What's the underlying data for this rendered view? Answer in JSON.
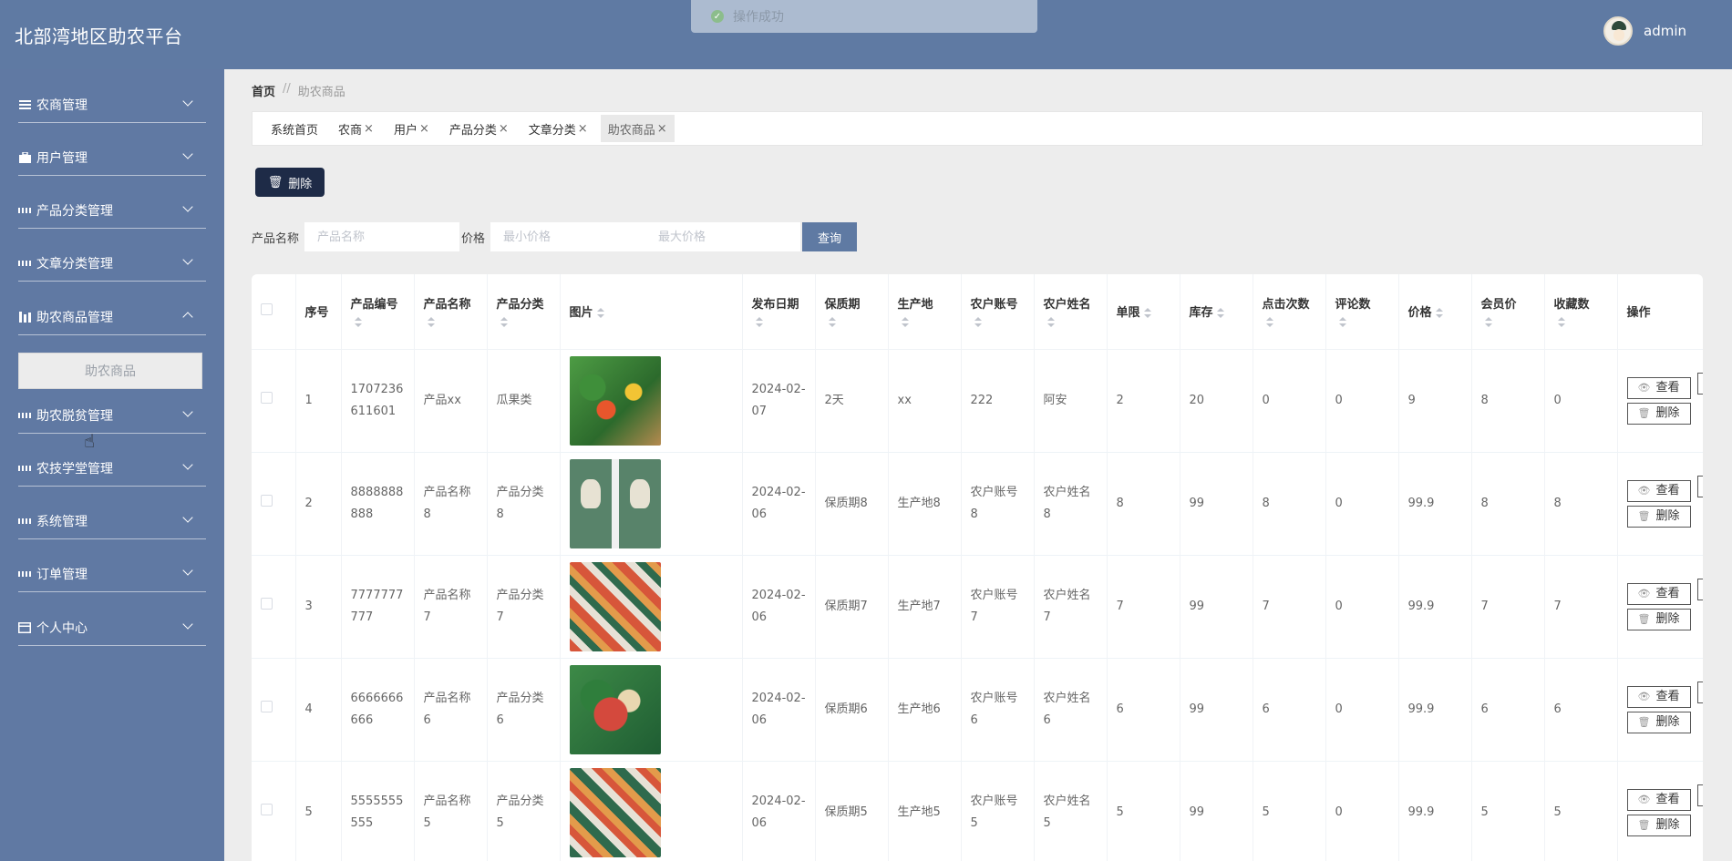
{
  "header": {
    "title": "北部湾地区助农平台",
    "username": "admin"
  },
  "toast": {
    "message": "操作成功"
  },
  "sidebar": {
    "items": [
      {
        "label": "农商管理",
        "icon": "list-icon"
      },
      {
        "label": "用户管理",
        "icon": "briefcase-icon"
      },
      {
        "label": "产品分类管理",
        "icon": "grid-icon"
      },
      {
        "label": "文章分类管理",
        "icon": "grid-icon"
      },
      {
        "label": "助农商品管理",
        "icon": "bar-chart-icon"
      },
      {
        "label": "助农脱贫管理",
        "icon": "grid-icon"
      },
      {
        "label": "农技学堂管理",
        "icon": "grid-icon"
      },
      {
        "label": "系统管理",
        "icon": "grid-icon"
      },
      {
        "label": "订单管理",
        "icon": "grid-icon"
      },
      {
        "label": "个人中心",
        "icon": "card-icon"
      }
    ],
    "sub_item": "助农商品"
  },
  "breadcrumb": {
    "home": "首页",
    "sep": "//",
    "current": "助农商品"
  },
  "tabs": [
    {
      "label": "系统首页",
      "closable": false
    },
    {
      "label": "农商",
      "closable": true
    },
    {
      "label": "用户",
      "closable": true
    },
    {
      "label": "产品分类",
      "closable": true
    },
    {
      "label": "文章分类",
      "closable": true
    },
    {
      "label": "助农商品",
      "closable": true
    }
  ],
  "toolbar": {
    "delete_label": "删除"
  },
  "search": {
    "name_label": "产品名称",
    "name_placeholder": "产品名称",
    "price_label": "价格",
    "min_placeholder": "最小价格",
    "max_placeholder": "最大价格",
    "query_label": "查询"
  },
  "table": {
    "headers": [
      "序号",
      "产品编号",
      "产品名称",
      "产品分类",
      "图片",
      "发布日期",
      "保质期",
      "生产地",
      "农户账号",
      "农户姓名",
      "单限",
      "库存",
      "点击次数",
      "评论数",
      "价格",
      "会员价",
      "收藏数",
      "操作"
    ],
    "view_label": "查看",
    "delete_label": "删除",
    "rows": [
      [
        "1",
        "1707236611601",
        "产品xx",
        "瓜果类",
        "",
        "2024-02-07",
        "2天",
        "xx",
        "222",
        "阿安",
        "2",
        "20",
        "0",
        "0",
        "9",
        "8",
        "0"
      ],
      [
        "2",
        "8888888888",
        "产品名称8",
        "产品分类8",
        "",
        "2024-02-06",
        "保质期8",
        "生产地8",
        "农户账号8",
        "农户姓名8",
        "8",
        "99",
        "8",
        "0",
        "99.9",
        "8",
        "8"
      ],
      [
        "3",
        "7777777777",
        "产品名称7",
        "产品分类7",
        "",
        "2024-02-06",
        "保质期7",
        "生产地7",
        "农户账号7",
        "农户姓名7",
        "7",
        "99",
        "7",
        "0",
        "99.9",
        "7",
        "7"
      ],
      [
        "4",
        "6666666666",
        "产品名称6",
        "产品分类6",
        "",
        "2024-02-06",
        "保质期6",
        "生产地6",
        "农户账号6",
        "农户姓名6",
        "6",
        "99",
        "6",
        "0",
        "99.9",
        "6",
        "6"
      ],
      [
        "5",
        "5555555555",
        "产品名称5",
        "产品分类5",
        "",
        "2024-02-06",
        "保质期5",
        "生产地5",
        "农户账号5",
        "农户姓名5",
        "5",
        "99",
        "5",
        "0",
        "99.9",
        "5",
        "5"
      ]
    ]
  }
}
